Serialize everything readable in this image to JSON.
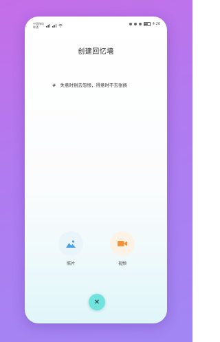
{
  "status_bar": {
    "carrier_line1": "中国移动",
    "carrier_line2": "联通",
    "time": "4:26"
  },
  "page": {
    "title": "创建回忆墙",
    "hint_symbol": "#",
    "hint_text": "失意时别去怨恨，得意时不去张扬"
  },
  "options": [
    {
      "label": "照片",
      "icon": "landscape-image-icon",
      "color": "#4aa3e0"
    },
    {
      "label": "视频",
      "icon": "video-camera-icon",
      "color": "#f5923a"
    }
  ],
  "close": {
    "symbol": "✕",
    "color": "#6fe3dc"
  },
  "colors": {
    "background_start": "#c46ee8",
    "background_end": "#a187f3"
  }
}
